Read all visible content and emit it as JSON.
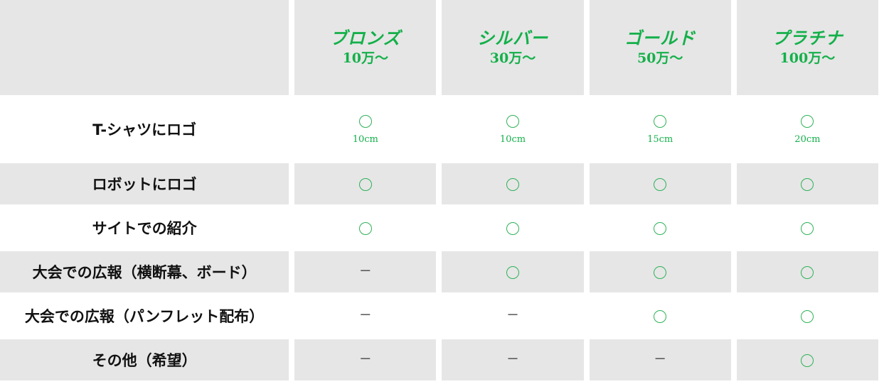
{
  "colors": {
    "accent_green": "#14b04a",
    "cell_shade": "#e6e6e6",
    "text_dark": "#111111"
  },
  "tiers": [
    {
      "name": "ブロンズ",
      "price": "10万〜"
    },
    {
      "name": "シルバー",
      "price": "30万〜"
    },
    {
      "name": "ゴールド",
      "price": "50万〜"
    },
    {
      "name": "プラチナ",
      "price": "100万〜"
    }
  ],
  "rows": [
    {
      "label": "T-シャツにロゴ",
      "marks": [
        "circle",
        "circle",
        "circle",
        "circle"
      ],
      "notes": [
        "10cm",
        "10cm",
        "15cm",
        "20cm"
      ]
    },
    {
      "label": "ロボットにロゴ",
      "marks": [
        "circle",
        "circle",
        "circle",
        "circle"
      ]
    },
    {
      "label": "サイトでの紹介",
      "marks": [
        "circle",
        "circle",
        "circle",
        "circle"
      ]
    },
    {
      "label": "大会での広報（横断幕、ボード）",
      "marks": [
        "dash",
        "circle",
        "circle",
        "circle"
      ]
    },
    {
      "label": "大会での広報（パンフレット配布）",
      "marks": [
        "dash",
        "dash",
        "circle",
        "circle"
      ]
    },
    {
      "label": "その他（希望）",
      "marks": [
        "dash",
        "dash",
        "dash",
        "circle"
      ]
    }
  ],
  "mark_glyphs": {
    "dash": "－"
  }
}
